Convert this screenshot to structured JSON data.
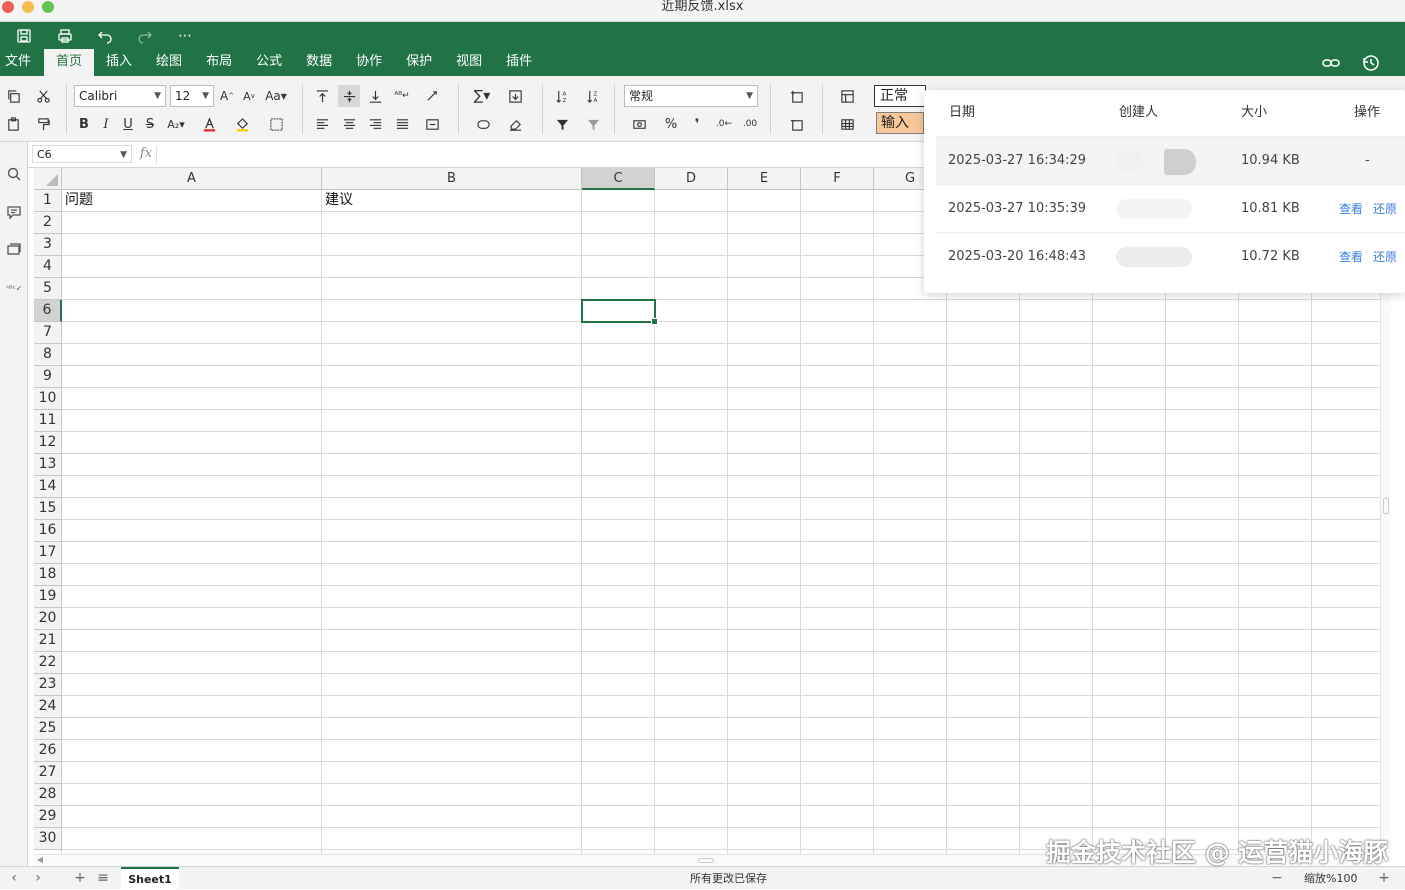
{
  "window": {
    "title": "近期反馈.xlsx"
  },
  "quick_access": {
    "more": "⋯"
  },
  "tabs": [
    {
      "label": "文件"
    },
    {
      "label": "首页"
    },
    {
      "label": "插入"
    },
    {
      "label": "绘图"
    },
    {
      "label": "布局"
    },
    {
      "label": "公式"
    },
    {
      "label": "数据"
    },
    {
      "label": "协作"
    },
    {
      "label": "保护"
    },
    {
      "label": "视图"
    },
    {
      "label": "插件"
    }
  ],
  "active_tab": "首页",
  "toolbar": {
    "font_name": "Calibri",
    "font_size": "12",
    "number_format": "常规",
    "bold": "B",
    "italic": "I",
    "underline": "U",
    "strike": "S",
    "percent": "%",
    "comma": "❜",
    "style_normal": "正常",
    "style_input": "输入"
  },
  "formula_bar": {
    "name_box": "C6",
    "fx": "fx",
    "value": ""
  },
  "columns": [
    "A",
    "B",
    "C",
    "D",
    "E",
    "F",
    "G"
  ],
  "rows": [
    "1",
    "2",
    "3",
    "4",
    "5",
    "6",
    "7",
    "8",
    "9",
    "10",
    "11",
    "12",
    "13",
    "14",
    "15",
    "16",
    "17",
    "18",
    "19",
    "20",
    "21",
    "22",
    "23",
    "24",
    "25",
    "26",
    "27",
    "28",
    "29",
    "30"
  ],
  "cells": {
    "A1": "问题",
    "B1": "建议"
  },
  "selected_cell": "C6",
  "history_panel": {
    "headers": {
      "date": "日期",
      "creator": "创建人",
      "size": "大小",
      "action": "操作"
    },
    "rows": [
      {
        "date": "2025-03-27 16:34:29",
        "size": "10.94 KB",
        "action": "-"
      },
      {
        "date": "2025-03-27 10:35:39",
        "size": "10.81 KB",
        "view": "查看",
        "restore": "还原"
      },
      {
        "date": "2025-03-20 16:48:43",
        "size": "10.72 KB",
        "view": "查看",
        "restore": "还原"
      }
    ]
  },
  "status": {
    "sheet": "Sheet1",
    "saved": "所有更改已保存",
    "zoom": "缩放%100",
    "zoom_out": "−",
    "zoom_in": "+"
  },
  "watermark": "掘金技术社区 @ 运营猫小海豚",
  "colors": {
    "accent": "#217346",
    "link": "#3b7fe0",
    "input_style": "#f8c79a"
  }
}
